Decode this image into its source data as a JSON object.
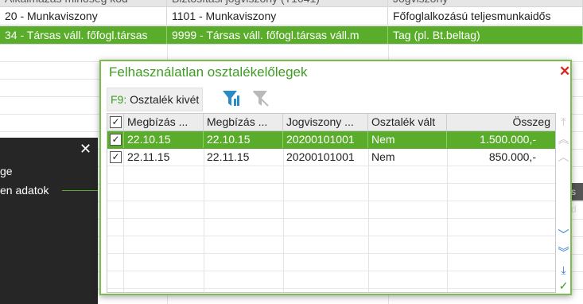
{
  "background_table": {
    "headers": [
      "Alkalmazás minőség kód",
      "Biztosítási jogviszony (T1041)",
      "Jogviszony"
    ],
    "rows": [
      [
        "20 - Munkaviszony",
        "1101 - Munkaviszony",
        "Főfoglalkozású teljesmunkaidős"
      ],
      [
        "34 - Társas váll. főfogl.társas",
        "9999 - Társas váll. főfogl.társas váll.m",
        "Tag (pl. Bt.beltag)"
      ]
    ]
  },
  "side_panel": {
    "item1": "ge",
    "item2": "en adatok"
  },
  "right_strip": "s d",
  "dialog": {
    "title": "Felhasználatlan osztalékelőlegek",
    "toolbar": {
      "key": "F9:",
      "label": "Osztalék kivét"
    },
    "columns": [
      "Megbízás ...",
      "Megbízás ...",
      "Jogviszony ...",
      "Osztalék vált",
      "Összeg"
    ],
    "rows": [
      {
        "checked": "✓",
        "cells": [
          "22.10.15",
          "22.10.15",
          "20200101001",
          "Nem",
          "1.500.000,-"
        ]
      },
      {
        "checked": "✓",
        "cells": [
          "22.11.15",
          "22.11.15",
          "20200101001",
          "Nem",
          "850.000,-"
        ]
      }
    ],
    "header_check": "✓"
  },
  "colors": {
    "accent": "#5aad2a",
    "title": "#3f9b23",
    "close": "#d9261c",
    "filter": "#2b8cc4"
  },
  "icons": [
    "close-icon",
    "filter-icon",
    "filter-clear-icon",
    "first-page-icon",
    "page-up-icon",
    "row-up-icon",
    "row-down-icon",
    "page-down-icon",
    "last-page-icon",
    "confirm-icon"
  ]
}
